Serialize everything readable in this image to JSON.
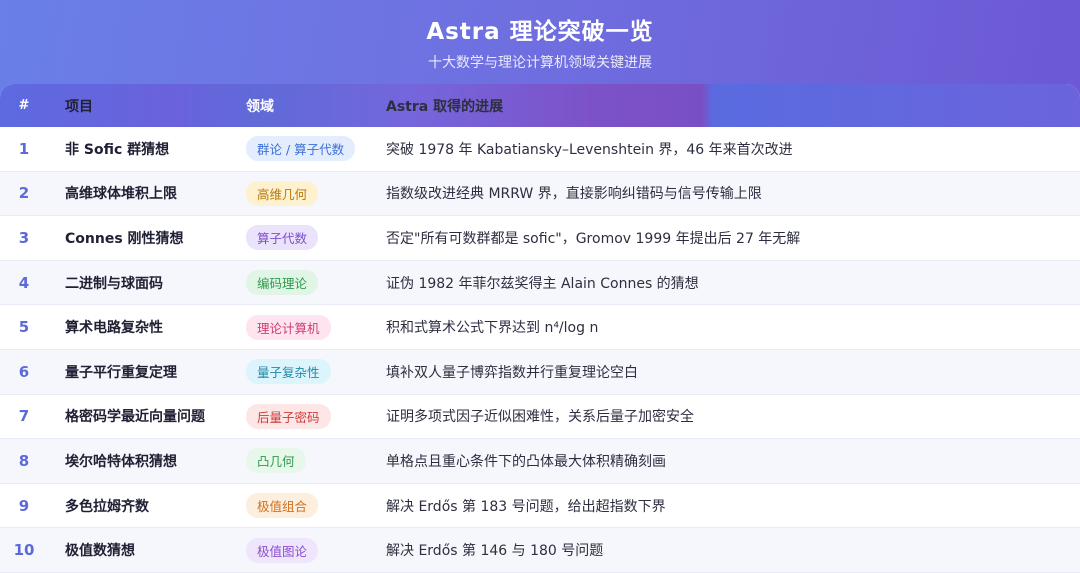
{
  "title": "Astra 理论突破一览",
  "subtitle": "十大数学与理论计算机领域关键进展",
  "columns": [
    "#",
    "项目",
    "领域",
    "Astra 取得的进展"
  ],
  "rows": [
    {
      "num": "1",
      "project": "非 Sofic 群猜想",
      "field": "群论 / 算子代数",
      "progress": "突破 1978 年 Kabatiansky–Levenshtein 界，46 年来首次改进",
      "badge_bg": "#e4edfd",
      "badge_fg": "#3b6fd8"
    },
    {
      "num": "2",
      "project": "高维球体堆积上限",
      "field": "高维几何",
      "progress": "指数级改进经典 MRRW 界，直接影响纠错码与信号传输上限",
      "badge_bg": "#fdf1cf",
      "badge_fg": "#b9790f"
    },
    {
      "num": "3",
      "project": "Connes 刚性猜想",
      "field": "算子代数",
      "progress": "否定\"所有可数群都是 sofic\"，Gromov 1999 年提出后 27 年无解",
      "badge_bg": "#ebe3fb",
      "badge_fg": "#7a4ec9"
    },
    {
      "num": "4",
      "project": "二进制与球面码",
      "field": "编码理论",
      "progress": "证伪 1982 年菲尔兹奖得主 Alain Connes 的猜想",
      "badge_bg": "#e1f5e6",
      "badge_fg": "#2f9a4d"
    },
    {
      "num": "5",
      "project": "算术电路复杂性",
      "field": "理论计算机",
      "progress": "积和式算术公式下界达到 n⁴/log n",
      "badge_bg": "#fde4ee",
      "badge_fg": "#cf3d77"
    },
    {
      "num": "6",
      "project": "量子平行重复定理",
      "field": "量子复杂性",
      "progress": "填补双人量子博弈指数并行重复理论空白",
      "badge_bg": "#dcf4fb",
      "badge_fg": "#1f8aa8"
    },
    {
      "num": "7",
      "project": "格密码学最近向量问题",
      "field": "后量子密码",
      "progress": "证明多项式因子近似困难性，关系后量子加密安全",
      "badge_bg": "#fde6e6",
      "badge_fg": "#cf3a3a"
    },
    {
      "num": "8",
      "project": "埃尔哈特体积猜想",
      "field": "凸几何",
      "progress": "单格点且重心条件下的凸体最大体积精确刻画",
      "badge_bg": "#e7f7ea",
      "badge_fg": "#2f9a4d"
    },
    {
      "num": "9",
      "project": "多色拉姆齐数",
      "field": "极值组合",
      "progress": "解决 Erdős 第 183 号问题，给出超指数下界",
      "badge_bg": "#fdeede",
      "badge_fg": "#d2701c"
    },
    {
      "num": "10",
      "project": "极值数猜想",
      "field": "极值图论",
      "progress": "解决 Erdős 第 146 与 180 号问题",
      "badge_bg": "#efe6fb",
      "badge_fg": "#8a4fcf"
    }
  ]
}
